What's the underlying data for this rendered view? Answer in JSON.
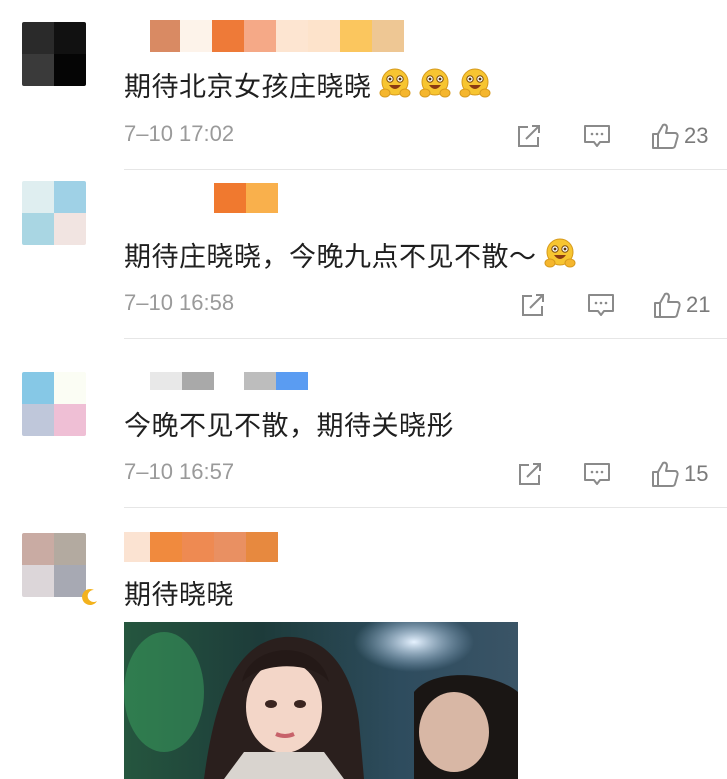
{
  "comments": [
    {
      "text": "期待北京女孩庄晓晓",
      "emojis": [
        "grinning-hug-emoji",
        "grinning-hug-emoji",
        "grinning-hug-emoji"
      ],
      "time": "7–10 17:02",
      "likes": "23"
    },
    {
      "text": "期待庄晓晓，今晚九点不见不散～",
      "emojis": [
        "grinning-hug-emoji"
      ],
      "time": "7–10 16:58",
      "likes": "21"
    },
    {
      "text": "今晚不见不散，期待关晓彤",
      "emojis": [],
      "time": "7–10 16:57",
      "likes": "15"
    },
    {
      "text": "期待晓晓",
      "emojis": [],
      "time": "",
      "likes": ""
    }
  ],
  "icons": {
    "share": "share-icon",
    "comment": "comment-icon",
    "like": "thumbs-up-icon"
  },
  "colors": {
    "meta_text": "#9a9a9a",
    "icon_stroke": "#8a8a8a",
    "separator": "#e6e6e6"
  }
}
